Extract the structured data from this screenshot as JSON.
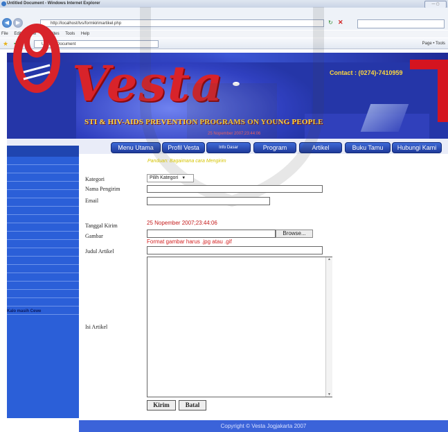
{
  "browser": {
    "title": "Untitled Document - Windows Internet Explorer",
    "url": "http://localhost/tvs/formkirimartikel.php",
    "menu": [
      "File",
      "Edit",
      "View",
      "Favorites",
      "Tools",
      "Help"
    ],
    "tab_label": "Untitled Document",
    "toolbar_right": "Page • Tools"
  },
  "header": {
    "logo_text": "Vesta",
    "contact": "Contact : (0274)-7410959",
    "tagline": "STI & HIV-AIDS PREVENTION PROGRAMS ON YOUNG PEOPLE",
    "date": "25 Nopember 2007;23:44:06"
  },
  "nav": [
    "Menu Utama",
    "Profil Vesta",
    "Info Dasar",
    "Program",
    "Artikel",
    "Buku Tamu",
    "Hubungi Kami"
  ],
  "sidebar": {
    "bottom_text": "Kalo masih Cewe"
  },
  "welcome": "Panduan: Bagaimana cara Mengirim",
  "form": {
    "kategori_label": "Kategori",
    "kategori_value": "Pilih Kategori",
    "nama_label": "Nama Pengirim",
    "email_label": "Email",
    "tanggal_label": "Tanggal Kirim",
    "tanggal_value": "25 Nopember 2007;23:44:06",
    "gambar_label": "Gambar",
    "browse_label": "Browse...",
    "format_note": "Format gambar harus .jpg atau .gif",
    "judul_label": "Judul Artikel",
    "isi_label": "Isi Artikel",
    "kirim_label": "Kirim",
    "batal_label": "Batal"
  },
  "footer": "Copyright © Vesta Jogjakarta 2007",
  "colors": {
    "brand_blue": "#2536a8",
    "sidebar_blue": "#2b5fd8",
    "accent_red": "#d8232a",
    "accent_yellow": "#ffd83c"
  }
}
